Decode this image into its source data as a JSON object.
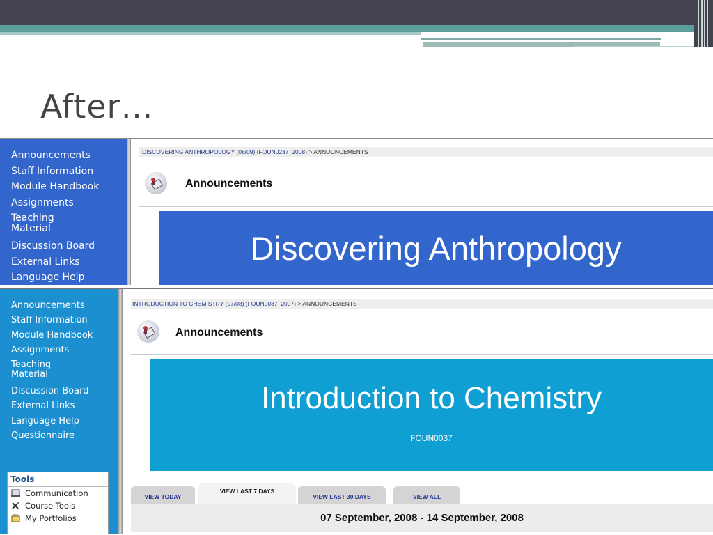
{
  "slide": {
    "title": "After…"
  },
  "panel1": {
    "nav_items": [
      "Announcements",
      "Staff Information",
      "Module Handbook",
      "Assignments",
      "Teaching\nMaterial",
      "Discussion Board",
      "External Links",
      "Language Help"
    ],
    "breadcrumb": {
      "link": "DISCOVERING ANTHROPOLOGY (08/09) (FOUN0237_2008)",
      "rest": " > ANNOUNCEMENTS"
    },
    "heading": "Announcements",
    "banner_title": "Discovering Anthropology",
    "colors": {
      "nav": "#3366cc",
      "banner": "#3366cc"
    }
  },
  "panel2": {
    "nav_items": [
      "Announcements",
      "Staff Information",
      "Module Handbook",
      "Assignments",
      "Teaching\nMaterial",
      "Discussion Board",
      "External Links",
      "Language Help",
      "Questionnaire"
    ],
    "breadcrumb": {
      "link": "INTRODUCTION TO CHEMISTRY (07/08) (FOUN0037_2007)",
      "rest": " > ANNOUNCEMENTS"
    },
    "heading": "Announcements",
    "banner_title": "Introduction to Chemistry",
    "banner_code": "FOUN0037",
    "tools": {
      "header": "Tools",
      "items": [
        {
          "label": "Communication",
          "icon": "communication-icon"
        },
        {
          "label": "Course Tools",
          "icon": "course-tools-icon"
        },
        {
          "label": "My Portfolios",
          "icon": "portfolio-icon"
        }
      ]
    },
    "tabs": [
      "VIEW TODAY",
      "VIEW LAST 7 DAYS",
      "VIEW LAST 30 DAYS",
      "VIEW ALL"
    ],
    "active_tab": "VIEW LAST 7 DAYS",
    "date_range": "07 September, 2008 - 14 September, 2008",
    "colors": {
      "nav": "#1b8fd0",
      "banner": "#0f9fd2"
    }
  }
}
